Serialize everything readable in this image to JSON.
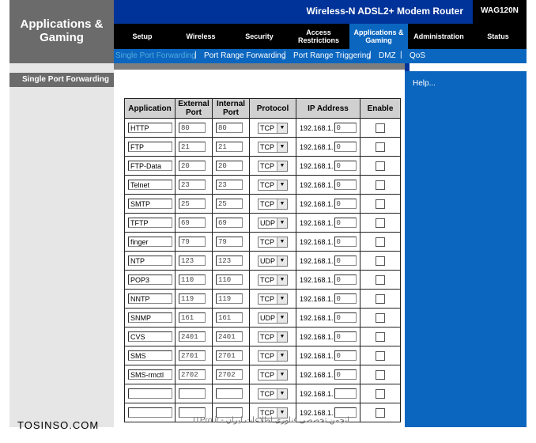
{
  "app_title_line1": "Applications &",
  "app_title_line2": "Gaming",
  "product_name": "Wireless-N ADSL2+ Modem Router",
  "model": "WAG120N",
  "tabs": [
    {
      "label": "Setup"
    },
    {
      "label": "Wireless"
    },
    {
      "label": "Security"
    },
    {
      "label": "Access Restrictions"
    },
    {
      "label": "Applications & Gaming"
    },
    {
      "label": "Administration"
    },
    {
      "label": "Status"
    }
  ],
  "subtabs": [
    {
      "label": "Single Port Forwarding"
    },
    {
      "label": "Port Range Forwarding"
    },
    {
      "label": "Port Range Triggering"
    },
    {
      "label": "DMZ"
    },
    {
      "label": "QoS"
    }
  ],
  "sidebar_section": "Single Port Forwarding",
  "help_link": "Help...",
  "table": {
    "headers": {
      "application": "Application",
      "external": "External Port",
      "internal": "Internal Port",
      "protocol": "Protocol",
      "ip": "IP Address",
      "enable": "Enable"
    },
    "ip_prefix": "192.168.1.",
    "rows": [
      {
        "app": "HTTP",
        "ext": "80",
        "int": "80",
        "proto": "TCP",
        "ip_last": "0"
      },
      {
        "app": "FTP",
        "ext": "21",
        "int": "21",
        "proto": "TCP",
        "ip_last": "0"
      },
      {
        "app": "FTP-Data",
        "ext": "20",
        "int": "20",
        "proto": "TCP",
        "ip_last": "0"
      },
      {
        "app": "Telnet",
        "ext": "23",
        "int": "23",
        "proto": "TCP",
        "ip_last": "0"
      },
      {
        "app": "SMTP",
        "ext": "25",
        "int": "25",
        "proto": "TCP",
        "ip_last": "0"
      },
      {
        "app": "TFTP",
        "ext": "69",
        "int": "69",
        "proto": "UDP",
        "ip_last": "0"
      },
      {
        "app": "finger",
        "ext": "79",
        "int": "79",
        "proto": "TCP",
        "ip_last": "0"
      },
      {
        "app": "NTP",
        "ext": "123",
        "int": "123",
        "proto": "UDP",
        "ip_last": "0"
      },
      {
        "app": "POP3",
        "ext": "110",
        "int": "110",
        "proto": "TCP",
        "ip_last": "0"
      },
      {
        "app": "NNTP",
        "ext": "119",
        "int": "119",
        "proto": "TCP",
        "ip_last": "0"
      },
      {
        "app": "SNMP",
        "ext": "161",
        "int": "161",
        "proto": "UDP",
        "ip_last": "0"
      },
      {
        "app": "CVS",
        "ext": "2401",
        "int": "2401",
        "proto": "TCP",
        "ip_last": "0"
      },
      {
        "app": "SMS",
        "ext": "2701",
        "int": "2701",
        "proto": "TCP",
        "ip_last": "0"
      },
      {
        "app": "SMS-rmctl",
        "ext": "2702",
        "int": "2702",
        "proto": "TCP",
        "ip_last": "0"
      },
      {
        "app": "",
        "ext": "",
        "int": "",
        "proto": "TCP",
        "ip_last": ""
      },
      {
        "app": "",
        "ext": "",
        "int": "",
        "proto": "TCP",
        "ip_last": ""
      }
    ]
  },
  "watermark_left": "TOSINSO.COM",
  "watermark_center": "ITPro.ir - انجمن تخصصی فناوری اطلاعات ایران",
  "colors": {
    "brand_blue": "#0b66bf",
    "dark_blue": "#003399"
  }
}
